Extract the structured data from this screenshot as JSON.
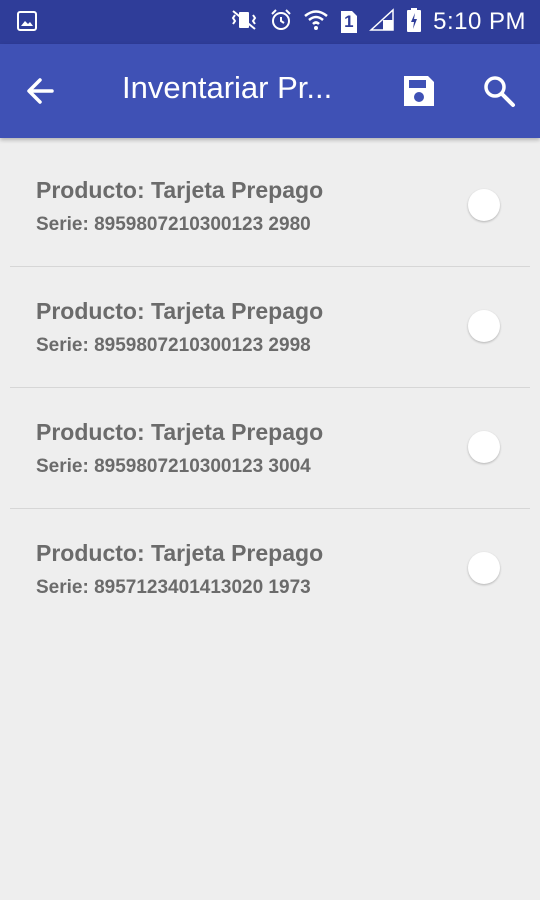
{
  "status_bar": {
    "time": "5:10 PM",
    "sim_slot": "1",
    "icons": [
      "image-icon",
      "vibrate-mute-icon",
      "alarm-icon",
      "wifi-icon",
      "sim-icon",
      "signal-icon",
      "battery-charging-icon"
    ]
  },
  "app_bar": {
    "title": "Inventariar Pr...",
    "icons": [
      "back-arrow-icon",
      "save-icon",
      "search-icon"
    ],
    "background": "#3f51b5",
    "status_background": "#2f3d99"
  },
  "items": [
    {
      "product": "Producto: Tarjeta Prepago",
      "serial": "Serie: 8959807210300123 2980",
      "selected": false
    },
    {
      "product": "Producto: Tarjeta Prepago",
      "serial": "Serie: 8959807210300123 2998",
      "selected": false
    },
    {
      "product": "Producto: Tarjeta Prepago",
      "serial": "Serie: 8959807210300123 3004",
      "selected": false
    },
    {
      "product": "Producto: Tarjeta Prepago",
      "serial": "Serie: 8957123401413020 1973",
      "selected": false
    }
  ]
}
